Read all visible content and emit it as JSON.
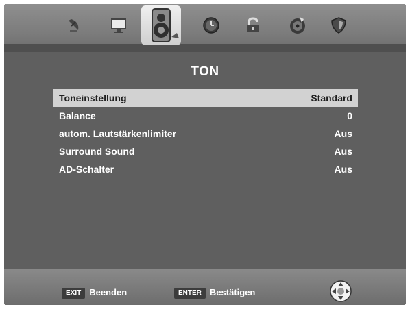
{
  "menu": {
    "tabs": [
      {
        "icon": "satellite-dish-icon"
      },
      {
        "icon": "monitor-icon"
      },
      {
        "icon": "speaker-icon",
        "active": true
      },
      {
        "icon": "clock-icon"
      },
      {
        "icon": "lock-icon"
      },
      {
        "icon": "settings-disc-icon"
      },
      {
        "icon": "shield-icon"
      }
    ],
    "title": "TON",
    "items": [
      {
        "label": "Toneinstellung",
        "value": "Standard"
      },
      {
        "label": "Balance",
        "value": "0"
      },
      {
        "label": "autom. Lautstärkenlimiter",
        "value": "Aus"
      },
      {
        "label": "Surround Sound",
        "value": "Aus"
      },
      {
        "label": "AD-Schalter",
        "value": "Aus"
      }
    ]
  },
  "footer": {
    "exit_key": "EXIT",
    "exit_label": "Beenden",
    "enter_key": "ENTER",
    "enter_label": "Bestätigen",
    "nav_icon": "navigation-pad-icon"
  },
  "colors": {
    "panel": "#5f5f5f",
    "selected_row": "#d2d2d2",
    "text": "#ffffff"
  }
}
